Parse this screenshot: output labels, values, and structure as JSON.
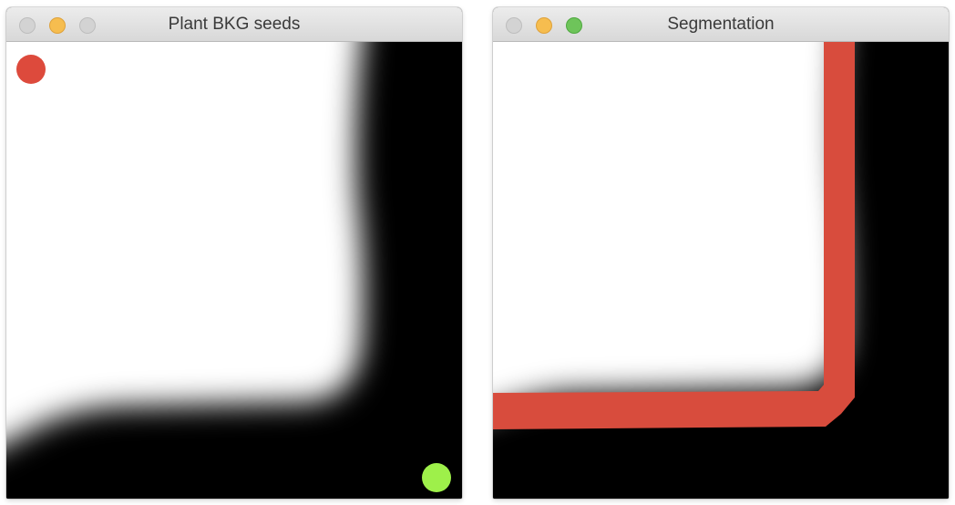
{
  "windows": [
    {
      "title": "Plant BKG seeds",
      "controls": [
        "close-button",
        "minimize-button",
        "zoom-button"
      ],
      "seeds": [
        {
          "label": "foreground-seed",
          "color": "#dd4a3c"
        },
        {
          "label": "background-seed",
          "color": "#9ef04a"
        }
      ]
    },
    {
      "title": "Segmentation",
      "controls": [
        "close-button",
        "minimize-button",
        "zoom-button"
      ],
      "boundary_color": "#d84c3d"
    }
  ],
  "colors": {
    "titlebar": "#e3e3e3",
    "close_inactive": "#d3d3d3",
    "minimize": "#f6bd4f",
    "zoom": "#6ec45a",
    "image_foreground": "#ffffff",
    "image_background": "#000000"
  }
}
